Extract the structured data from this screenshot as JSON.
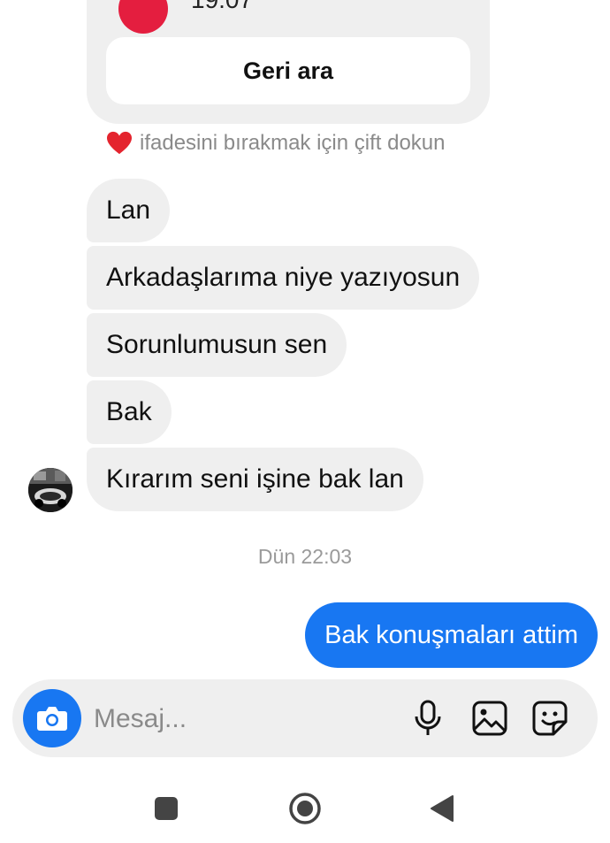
{
  "call_card": {
    "time_text": "19:07",
    "callback_label": "Geri ara"
  },
  "reaction_hint": {
    "icon": "heart-icon",
    "text": "ifadesini bırakmak için çift dokun"
  },
  "incoming_messages": [
    "Lan",
    "Arkadaşlarıma niye yazıyosun",
    "Sorunlumusun sen",
    "Bak",
    "Kırarım seni işine bak lan"
  ],
  "timestamp": "Dün 22:03",
  "outgoing_messages": [
    "Bak konuşmaları attim"
  ],
  "composer": {
    "placeholder": "Mesaj...",
    "icons": [
      "camera-icon",
      "microphone-icon",
      "gallery-icon",
      "sticker-icon"
    ]
  },
  "nav_bar": {
    "icons": [
      "recents-icon",
      "home-icon",
      "back-icon"
    ]
  },
  "colors": {
    "accent": "#1877f2",
    "incoming_bubble": "#efefef",
    "call_red": "#e41e3f"
  }
}
